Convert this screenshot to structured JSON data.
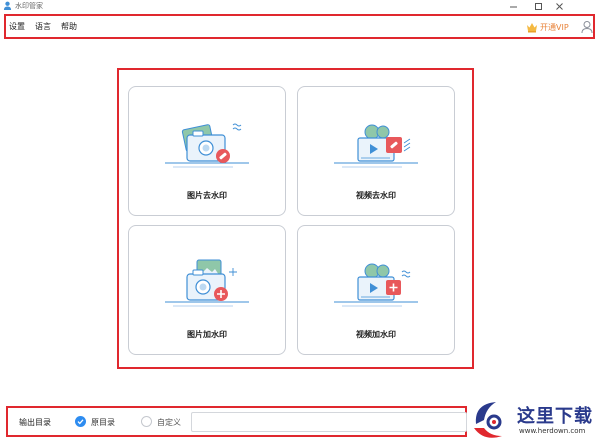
{
  "window": {
    "title": "水印管家",
    "controls": [
      "minimize",
      "maximize",
      "close"
    ]
  },
  "menu": {
    "items": [
      {
        "label": "设置"
      },
      {
        "label": "语言"
      },
      {
        "label": "帮助"
      }
    ],
    "vip_label": "开通VIP",
    "vip_icon": "crown-icon",
    "user_icon": "user-icon"
  },
  "tools": [
    {
      "label": "图片去水印",
      "icon": "photo-remove-watermark-icon"
    },
    {
      "label": "视频去水印",
      "icon": "video-remove-watermark-icon"
    },
    {
      "label": "图片加水印",
      "icon": "photo-add-watermark-icon"
    },
    {
      "label": "视频加水印",
      "icon": "video-add-watermark-icon"
    }
  ],
  "output": {
    "label": "输出目录",
    "options": [
      {
        "label": "原目录",
        "selected": true
      },
      {
        "label": "自定义",
        "selected": false
      }
    ],
    "path_value": ""
  },
  "watermark": {
    "title": "这里下载",
    "url": "www.herdown.com"
  },
  "colors": {
    "accent": "#2d8cf0",
    "highlight": "#e0282e",
    "vip": "#e8833a",
    "icon_blue": "#3f8fd6",
    "icon_red": "#e8585b"
  }
}
